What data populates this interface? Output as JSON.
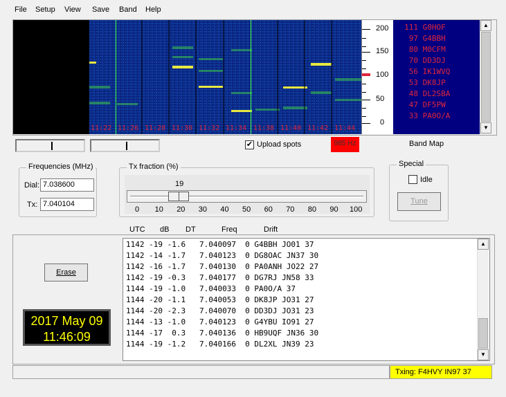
{
  "menu": {
    "file": "File",
    "setup": "Setup",
    "view": "View",
    "save": "Save",
    "band": "Band",
    "help": "Help"
  },
  "waterfall": {
    "time_labels": [
      "11:22",
      "11:26",
      "11:28",
      "11:30",
      "11:32",
      "11:34",
      "11:38",
      "11:40",
      "11:42",
      "11:44"
    ],
    "scale_labels": [
      "200",
      "150",
      "100",
      "50",
      "0"
    ],
    "freq_marker_label": "985 Hz"
  },
  "bandmap": {
    "label": "Band Map",
    "rows": [
      {
        "count": "111",
        "call": "G0HOF"
      },
      {
        "count": "97",
        "call": "G4BBH"
      },
      {
        "count": "80",
        "call": "M0CFM"
      },
      {
        "count": "70",
        "call": "DD3DJ"
      },
      {
        "count": "56",
        "call": "IK1WVQ"
      },
      {
        "count": "53",
        "call": "DK8JP"
      },
      {
        "count": "48",
        "call": "DL2SBA"
      },
      {
        "count": "47",
        "call": "DF5PW"
      },
      {
        "count": "33",
        "call": "PA0O/A"
      }
    ]
  },
  "upload_spots": {
    "label": "Upload spots",
    "checked": true
  },
  "frequencies": {
    "title": "Frequencies (MHz)",
    "dial_label": "Dial:",
    "dial_value": "7.038600",
    "tx_label": "Tx:",
    "tx_value": "7.040104"
  },
  "tx_fraction": {
    "title": "Tx fraction (%)",
    "value_label": "19",
    "value": 19,
    "ticks": [
      "0",
      "10",
      "20",
      "30",
      "40",
      "50",
      "60",
      "70",
      "80",
      "90",
      "100"
    ]
  },
  "special": {
    "title": "Special",
    "idle_label": "Idle",
    "tune_label": "Tune"
  },
  "erase_label": "Erase",
  "clock": {
    "date": "2017 May 09",
    "time": "11:46:09"
  },
  "decode": {
    "headers": {
      "utc": "UTC",
      "db": "dB",
      "dt": "DT",
      "freq": "Freq",
      "drift": "Drift"
    },
    "rows": [
      "1142 -19 -1.6   7.040097  0 G4BBH JO01 37",
      "1142 -14 -1.7   7.040123  0 DG8OAC JN37 30",
      "1142 -16 -1.7   7.040130  0 PA0ANH JO22 27",
      "1142 -19 -0.3   7.040177  0 DG7RJ JN58 33",
      "1144 -19 -1.0   7.040033  0 PA0O/A 37",
      "1144 -20 -1.1   7.040053  0 DK8JP JO31 27",
      "1144 -20 -2.3   7.040070  0 DD3DJ JO31 23",
      "1144 -13 -1.0   7.040123  0 G4YBU IO91 27",
      "1144 -17  0.3   7.040136  0 HB9UQF JN36 30",
      "1144 -19 -1.2   7.040166  0 DL2XL JN39 23"
    ]
  },
  "status": {
    "txing": "Txing: F4HVY IN97 37"
  },
  "colors": {
    "waterfall_bg": "#0a1a6e",
    "bandmap_bg": "#000080",
    "accent_red": "#e0263d",
    "status_yellow": "#ffff00",
    "clock_text": "#ffff00"
  }
}
